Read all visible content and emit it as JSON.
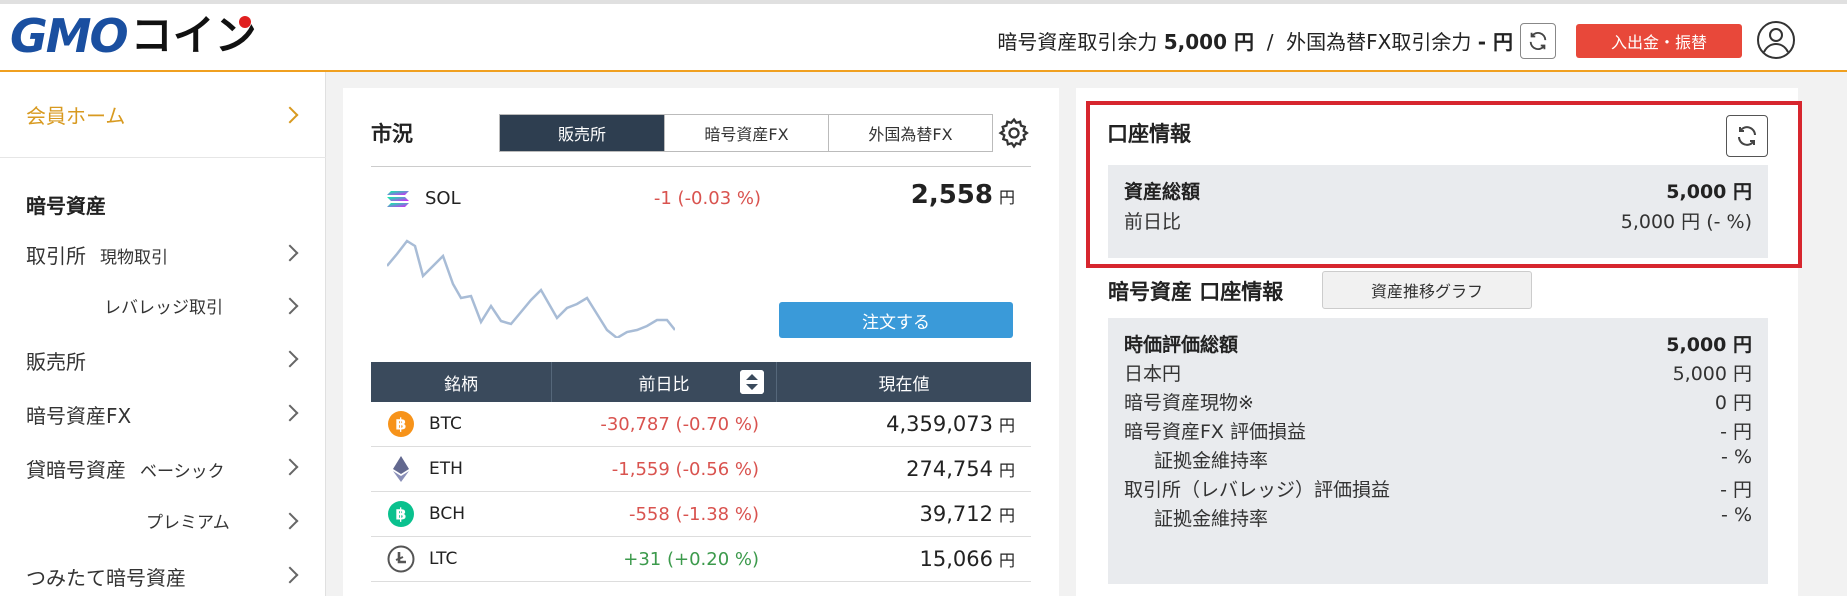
{
  "header": {
    "logo_gmo": "GMO",
    "logo_coin": "コイン",
    "balance_label1": "暗号資産取引余力",
    "balance_value1": "5,000 円",
    "balance_sep": "/",
    "balance_label2": "外国為替FX取引余力",
    "balance_value2": "- 円",
    "deposit_button": "入出金・振替"
  },
  "sidebar": {
    "home": "会員ホーム",
    "section_title": "暗号資産",
    "items": [
      {
        "label": "取引所",
        "sub": "現物取引"
      },
      {
        "label": "レバレッジ取引"
      },
      {
        "label": "販売所"
      },
      {
        "label": "暗号資産FX"
      },
      {
        "label": "貸暗号資産",
        "sub": "ベーシック"
      },
      {
        "label": "プレミアム"
      },
      {
        "label": "つみたて暗号資産"
      }
    ]
  },
  "market": {
    "title": "市況",
    "tabs": [
      "販売所",
      "暗号資産FX",
      "外国為替FX"
    ],
    "active_tab": "販売所",
    "featured": {
      "symbol": "SOL",
      "change": "-1 (-0.03 %)",
      "price": "2,558",
      "unit": "円"
    },
    "order_button": "注文する",
    "columns": [
      "銘柄",
      "前日比",
      "現在値"
    ],
    "rows": [
      {
        "symbol": "BTC",
        "change": "-30,787 (-0.70 %)",
        "direction": "neg",
        "price": "4,359,073",
        "unit": "円",
        "icon": "btc-icon",
        "color": "#f7931a"
      },
      {
        "symbol": "ETH",
        "change": "-1,559 (-0.56 %)",
        "direction": "neg",
        "price": "274,754",
        "unit": "円",
        "icon": "eth-icon",
        "color": "#62688f"
      },
      {
        "symbol": "BCH",
        "change": "-558 (-1.38 %)",
        "direction": "neg",
        "price": "39,712",
        "unit": "円",
        "icon": "bch-icon",
        "color": "#0ac18e"
      },
      {
        "symbol": "LTC",
        "change": "+31 (+0.20 %)",
        "direction": "pos",
        "price": "15,066",
        "unit": "円",
        "icon": "ltc-icon",
        "color": "#555555"
      }
    ]
  },
  "account": {
    "title": "口座情報",
    "total_label": "資産総額",
    "total_value": "5,000 円",
    "prev_label": "前日比",
    "prev_value": "5,000 円 (- %)",
    "crypto_title": "暗号資産 口座情報",
    "graph_button": "資産推移グラフ",
    "details": [
      {
        "label": "時価評価総額",
        "value": "5,000 円",
        "bold": true
      },
      {
        "label": "日本円",
        "value": "5,000 円"
      },
      {
        "label": "暗号資産現物※",
        "value": "0 円"
      },
      {
        "label": "暗号資産FX 評価損益",
        "value": "- 円"
      },
      {
        "label": "証拠金維持率",
        "value": "- %",
        "indent": true
      },
      {
        "label": "取引所（レバレッジ）評価損益",
        "value": "- 円"
      },
      {
        "label": "証拠金維持率",
        "value": "- %",
        "indent": true
      }
    ]
  },
  "colors": {
    "accent_orange": "#f0a020",
    "deposit_red": "#e8483a",
    "highlight_red": "#d7262e",
    "tab_dark": "#2e3e50",
    "order_blue": "#3a9ad9"
  }
}
